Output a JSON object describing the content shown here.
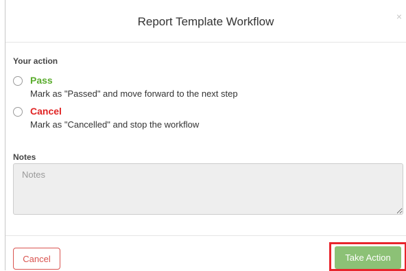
{
  "modal": {
    "title": "Report Template Workflow",
    "close_symbol": "×"
  },
  "action_section": {
    "label": "Your action",
    "options": [
      {
        "title": "Pass",
        "description": "Mark as \"Passed\" and move forward to the next step",
        "selected": false
      },
      {
        "title": "Cancel",
        "description": "Mark as \"Cancelled\" and stop the workflow",
        "selected": false
      }
    ]
  },
  "notes_section": {
    "label": "Notes",
    "placeholder": "Notes",
    "value": ""
  },
  "footer": {
    "cancel_label": "Cancel",
    "take_action_label": "Take Action"
  },
  "colors": {
    "pass": "#5aac2d",
    "cancel": "#e02424",
    "take_action_button": "#8cc176",
    "highlight": "#e8242c"
  },
  "icons": {
    "close": "close-icon"
  }
}
